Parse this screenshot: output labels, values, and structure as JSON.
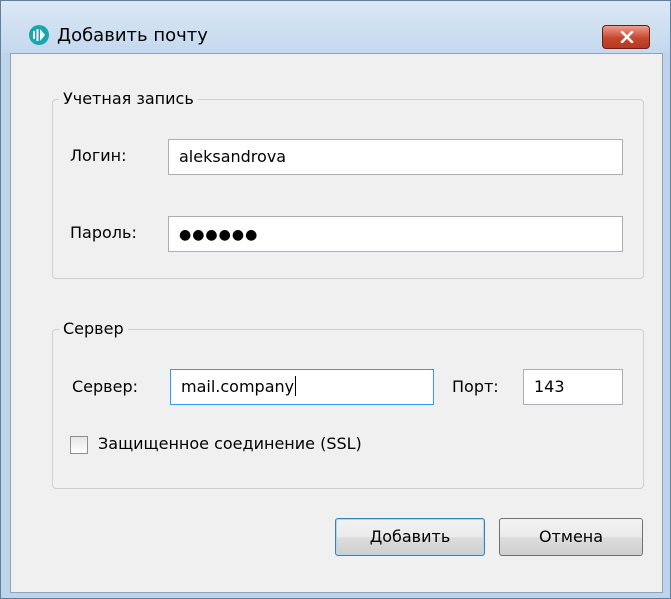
{
  "window": {
    "title": "Добавить почту",
    "icon": "app-logo-icon",
    "close_icon": "close-icon"
  },
  "account_group": {
    "legend": "Учетная запись",
    "login_label": "Логин:",
    "login_value": "aleksandrova",
    "password_label": "Пароль:",
    "password_masked": "●●●●●●"
  },
  "server_group": {
    "legend": "Сервер",
    "server_label": "Сервер:",
    "server_value": "mail.company",
    "port_label": "Порт:",
    "port_value": "143",
    "ssl_label": "Защищенное соединение (SSL)",
    "ssl_checked": false
  },
  "buttons": {
    "add_label": "Добавить",
    "cancel_label": "Отмена"
  },
  "colors": {
    "focus_border": "#3399ff",
    "close_button": "#c7462e",
    "app_icon": "#1aa5ac"
  }
}
